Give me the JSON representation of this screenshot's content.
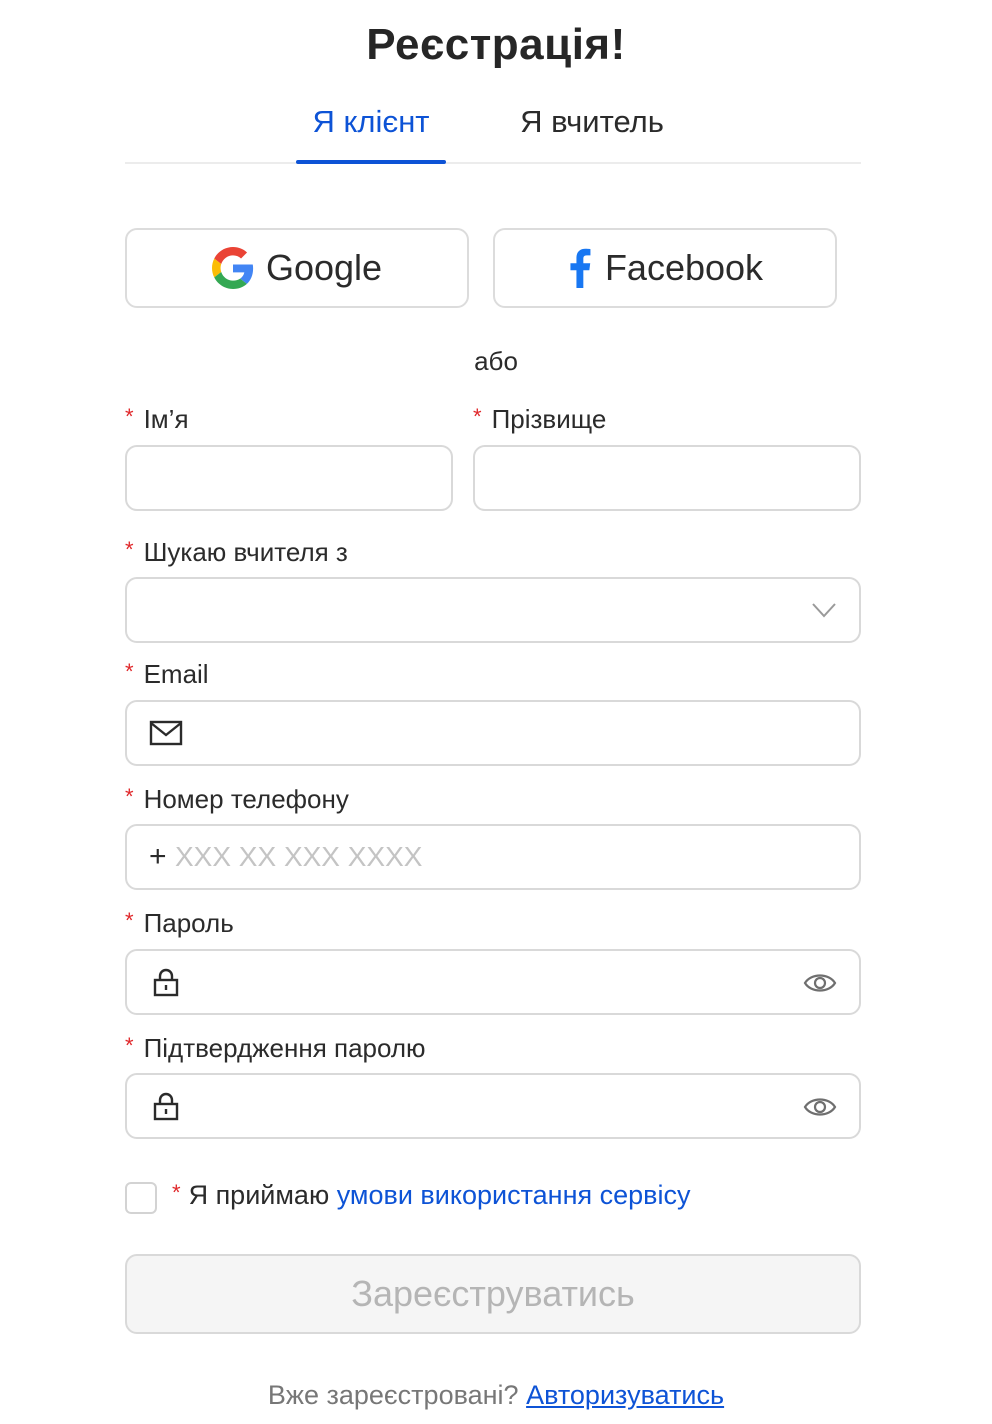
{
  "title": "Реєстрація!",
  "tabs": [
    {
      "label": "Я клієнт",
      "active": true
    },
    {
      "label": "Я вчитель",
      "active": false
    }
  ],
  "social": {
    "google_label": "Google",
    "facebook_label": "Facebook"
  },
  "divider_text": "або",
  "form": {
    "required_mark": "*",
    "first_name": {
      "label": "Ім’я",
      "value": ""
    },
    "last_name": {
      "label": "Прізвище",
      "value": ""
    },
    "subject": {
      "label": "Шукаю вчителя з",
      "value": ""
    },
    "email": {
      "label": "Email",
      "value": ""
    },
    "phone": {
      "label": "Номер телефону",
      "prefix": "+",
      "placeholder": "XXX XX XXX XXXX",
      "value": ""
    },
    "password": {
      "label": "Пароль",
      "value": ""
    },
    "password_confirm": {
      "label": "Підтвердження паролю",
      "value": ""
    },
    "terms": {
      "prefix": "Я приймаю",
      "link_text": "умови використання сервісу",
      "checked": false
    },
    "submit_label": "Зареєструватись"
  },
  "footer": {
    "text": "Вже зареєстровані?",
    "link_text": "Авторизуватись"
  },
  "colors": {
    "accent": "#0d53d6",
    "required": "#e0282b",
    "border": "#d9d9d9",
    "disabled_text": "#b5b5b5"
  },
  "icons": {
    "google": "google-icon",
    "facebook": "facebook-icon",
    "email": "envelope-icon",
    "lock": "lock-icon",
    "show_password": "eye-icon",
    "dropdown": "chevron-down-icon"
  }
}
